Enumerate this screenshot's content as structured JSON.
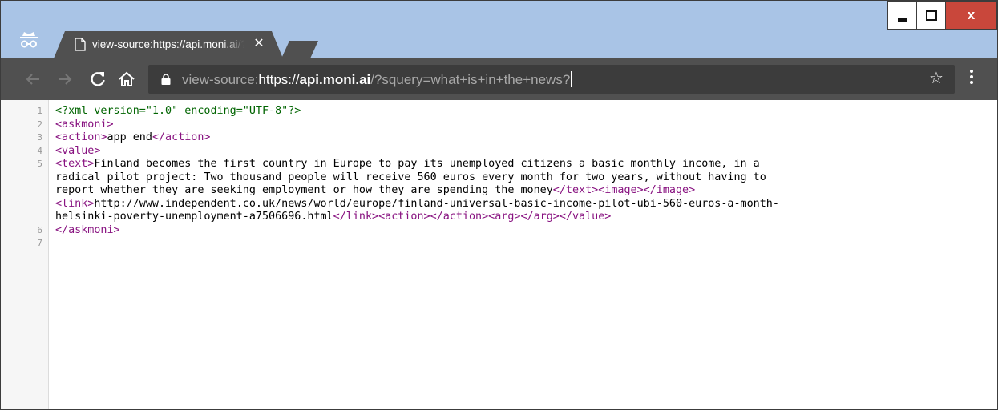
{
  "colors": {
    "frame": "#a9c4e6",
    "toolbar": "#505050",
    "omnibox": "#3c3c3c",
    "tag": "#881280",
    "pi": "#006400",
    "close": "#c9473b"
  },
  "tab": {
    "title": "view-source:https://api.moni.ai/?squery=what+is+in+the+news?",
    "close_glyph": "✕",
    "page_icon": "page-icon"
  },
  "window": {
    "close_glyph": "x"
  },
  "address": {
    "prefix": "view-source:",
    "scheme": "https://",
    "host": "api.moni.ai",
    "path": "/?squery=what+is+in+the+news?"
  },
  "toolbar": {
    "star_glyph": "☆"
  },
  "source": {
    "lines": [
      {
        "n": "1",
        "parts": [
          {
            "k": "pi",
            "t": "<?xml version=\"1.0\" encoding=\"UTF-8\"?>"
          }
        ]
      },
      {
        "n": "2",
        "parts": [
          {
            "k": "tag",
            "t": "<askmoni>"
          }
        ]
      },
      {
        "n": "3",
        "parts": [
          {
            "k": "tag",
            "t": "<action>"
          },
          {
            "k": "text",
            "t": "app end"
          },
          {
            "k": "tag",
            "t": "</action>"
          }
        ]
      },
      {
        "n": "4",
        "parts": [
          {
            "k": "tag",
            "t": "<value>"
          }
        ]
      },
      {
        "n": "5",
        "parts": [
          {
            "k": "tag",
            "t": "<text>"
          },
          {
            "k": "text",
            "t": "Finland becomes the first country in Europe to pay its unemployed citizens a basic monthly income, in a"
          }
        ]
      },
      {
        "n": "",
        "parts": [
          {
            "k": "text",
            "t": "radical pilot project: Two thousand people will receive 560 euros every month for two years, without having to"
          }
        ]
      },
      {
        "n": "",
        "parts": [
          {
            "k": "text",
            "t": "report whether they are seeking employment or how they are spending the money"
          },
          {
            "k": "tag",
            "t": "</text><image></image>"
          }
        ]
      },
      {
        "n": "",
        "parts": [
          {
            "k": "tag",
            "t": "<link>"
          },
          {
            "k": "text",
            "t": "http://www.independent.co.uk/news/world/europe/finland-universal-basic-income-pilot-ubi-560-euros-a-month-"
          }
        ]
      },
      {
        "n": "",
        "parts": [
          {
            "k": "text",
            "t": "helsinki-poverty-unemployment-a7506696.html"
          },
          {
            "k": "tag",
            "t": "</link><action></action><arg></arg></value>"
          }
        ]
      },
      {
        "n": "6",
        "parts": [
          {
            "k": "tag",
            "t": "</askmoni>"
          }
        ]
      },
      {
        "n": "7",
        "parts": []
      }
    ]
  }
}
